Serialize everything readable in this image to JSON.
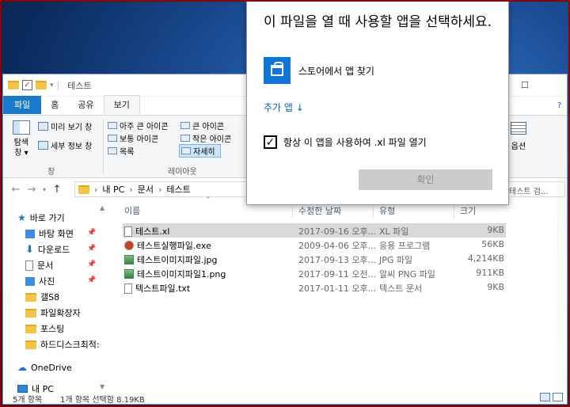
{
  "window": {
    "title": "테스트"
  },
  "ribbon": {
    "tabs": [
      "파일",
      "홈",
      "공유",
      "보기"
    ],
    "pane_btn": "탐색\n창",
    "pane_btn_line1": "탐색",
    "pane_btn_line2": "창 ▾",
    "preview_pane": "미리 보기 창",
    "details_pane": "세부 정보 창",
    "group_pane": "창",
    "layout": {
      "extra_large": "아주 큰 아이콘",
      "large": "큰 아이콘",
      "medium": "보통 아이콘",
      "small": "작은 아이콘",
      "list": "목록",
      "details": "자세히"
    },
    "group_layout": "레이아웃",
    "options": "옵션"
  },
  "address": {
    "pc": "내 PC",
    "documents": "문서",
    "folder": "테스트",
    "search_placeholder": "테스트 검..."
  },
  "nav": {
    "quick_access": "바로 가기",
    "items": [
      "바탕 화면",
      "다운로드",
      "문서",
      "사진",
      "갤S8",
      "파일확장자",
      "포스팅",
      "하드디스크최적:"
    ],
    "onedrive": "OneDrive",
    "thispc": "내 PC"
  },
  "columns": {
    "name": "이름",
    "date": "수정한 날짜",
    "type": "유형",
    "size": "크기"
  },
  "files": [
    {
      "name": "테스트.xl",
      "date": "2017-09-16 오후...",
      "type": "XL 파일",
      "size": "9KB",
      "icon": "document-icon"
    },
    {
      "name": "테스트실행파일.exe",
      "date": "2009-04-06 오후...",
      "type": "응용 프로그램",
      "size": "56KB",
      "icon": "exe-icon"
    },
    {
      "name": "테스트이미지파일.jpg",
      "date": "2017-09-13 오후...",
      "type": "JPG 파일",
      "size": "4,214KB",
      "icon": "image-icon"
    },
    {
      "name": "테스트이미지파일1.png",
      "date": "2017-09-11 오전...",
      "type": "알씨 PNG 파일",
      "size": "911KB",
      "icon": "image-icon"
    },
    {
      "name": "텍스트파일.txt",
      "date": "2017-01-11 오후...",
      "type": "텍스트 문서",
      "size": "9KB",
      "icon": "document-icon"
    }
  ],
  "status": {
    "count": "5개 항목",
    "selected": "1개 항목 선택함 8.19KB"
  },
  "dialog": {
    "title": "이 파일을 열 때 사용할 앱을 선택하세요.",
    "store": "스토어에서 앱 찾기",
    "more_apps": "추가 앱 ↓",
    "always_use": "항상 이 앱을 사용하여 .xl 파일 열기",
    "ok": "확인"
  },
  "colors": {
    "file_tab": "#1979ca",
    "store_tile": "#0e76d8",
    "link": "#0a63c8"
  }
}
